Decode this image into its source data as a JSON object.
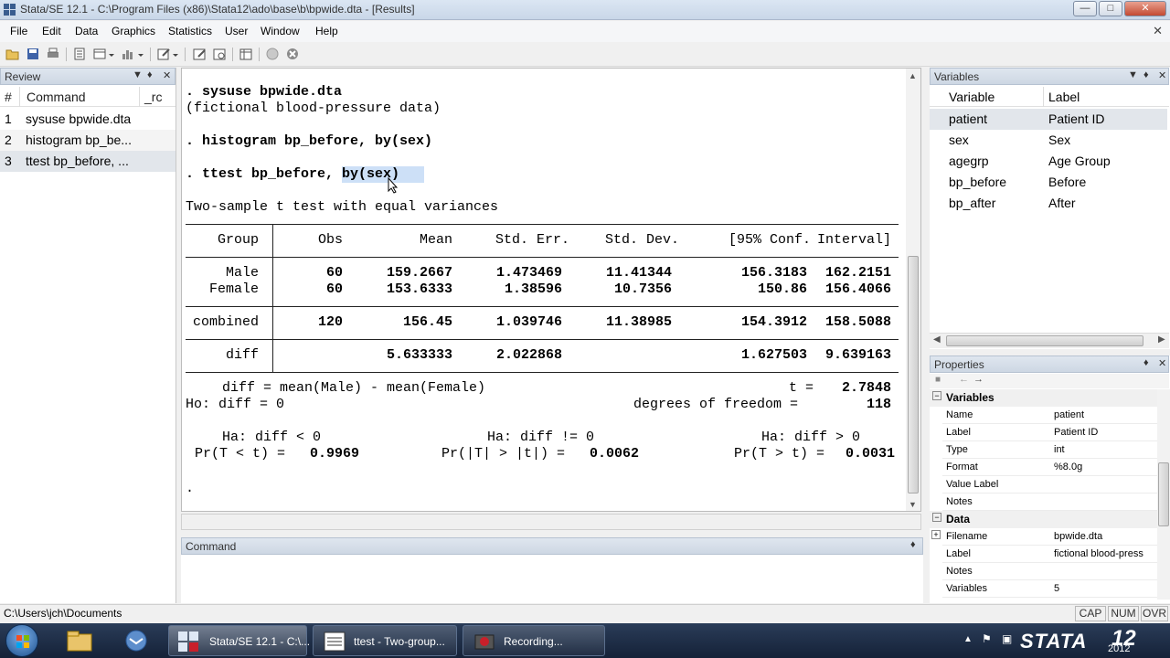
{
  "window": {
    "title": "Stata/SE 12.1 - C:\\Program Files (x86)\\Stata12\\ado\\base\\b\\bpwide.dta - [Results]"
  },
  "menu": [
    "File",
    "Edit",
    "Data",
    "Graphics",
    "Statistics",
    "User",
    "Window",
    "Help"
  ],
  "review": {
    "title": "Review",
    "columns": {
      "num": "#",
      "command": "Command",
      "rc": "_rc"
    },
    "rows": [
      {
        "num": "1",
        "command": "sysuse bpwide.dta"
      },
      {
        "num": "2",
        "command": "histogram bp_be..."
      },
      {
        "num": "3",
        "command": "ttest bp_before, ..."
      }
    ]
  },
  "results": {
    "lines": [
      ". sysuse bpwide.dta",
      "(fictional blood-pressure data)",
      "",
      ". histogram bp_before, by(sex)",
      "",
      ". ttest bp_before, by(sex)",
      "",
      "Two-sample t test with equal variances"
    ],
    "table": {
      "headers": [
        "Group",
        "Obs",
        "Mean",
        "Std. Err.",
        "Std. Dev.",
        "[95% Conf.",
        "Interval]"
      ],
      "groups": [
        {
          "name": "Male",
          "obs": "60",
          "mean": "159.2667",
          "se": "1.473469",
          "sd": "11.41344",
          "lo": "156.3183",
          "hi": "162.2151"
        },
        {
          "name": "Female",
          "obs": "60",
          "mean": "153.6333",
          "se": "1.38596",
          "sd": "10.7356",
          "lo": "150.86",
          "hi": "156.4066"
        }
      ],
      "combined": {
        "name": "combined",
        "obs": "120",
        "mean": "156.45",
        "se": "1.039746",
        "sd": "11.38985",
        "lo": "154.3912",
        "hi": "158.5088"
      },
      "diff": {
        "name": "diff",
        "mean": "5.633333",
        "se": "2.022868",
        "lo": "1.627503",
        "hi": "9.639163"
      }
    },
    "summary": {
      "diff_def": "diff = mean(Male) - mean(Female)",
      "t": "2.7848",
      "ho": "Ho: diff = 0",
      "df_label": "degrees of freedom =",
      "df": "118",
      "ha_lt": "Ha: diff < 0",
      "ha_ne": "Ha: diff != 0",
      "ha_gt": "Ha: diff > 0",
      "p_lt": "0.9969",
      "p_ne": "0.0062",
      "p_gt": "0.0031"
    },
    "prompt": "."
  },
  "command": {
    "title": "Command",
    "value": ""
  },
  "variables": {
    "title": "Variables",
    "columns": {
      "name": "Variable",
      "label": "Label"
    },
    "rows": [
      {
        "name": "patient",
        "label": "Patient ID"
      },
      {
        "name": "sex",
        "label": "Sex"
      },
      {
        "name": "agegrp",
        "label": "Age Group"
      },
      {
        "name": "bp_before",
        "label": "Before"
      },
      {
        "name": "bp_after",
        "label": "After"
      }
    ]
  },
  "properties": {
    "title": "Properties",
    "var_group": "Variables",
    "var_props": [
      {
        "k": "Name",
        "v": "patient"
      },
      {
        "k": "Label",
        "v": "Patient ID"
      },
      {
        "k": "Type",
        "v": "int"
      },
      {
        "k": "Format",
        "v": "%8.0g"
      },
      {
        "k": "Value Label",
        "v": ""
      },
      {
        "k": "Notes",
        "v": ""
      }
    ],
    "data_group": "Data",
    "data_props": [
      {
        "k": "Filename",
        "v": "bpwide.dta"
      },
      {
        "k": "Label",
        "v": "fictional blood-press"
      },
      {
        "k": "Notes",
        "v": ""
      },
      {
        "k": "Variables",
        "v": "5"
      }
    ]
  },
  "status": {
    "path": "C:\\Users\\jch\\Documents",
    "caps": "CAP",
    "num": "NUM",
    "ovr": "OVR"
  },
  "taskbar": {
    "tasks": [
      "Stata/SE 12.1 - C:\\...",
      "ttest - Two-group...",
      "Recording..."
    ],
    "logo_text": "STATA",
    "version": "12",
    "clock": "2012"
  },
  "colors": {
    "accent": "#3a5d8f",
    "selection": "#cde0f7",
    "stata_red": "#c8202a"
  }
}
